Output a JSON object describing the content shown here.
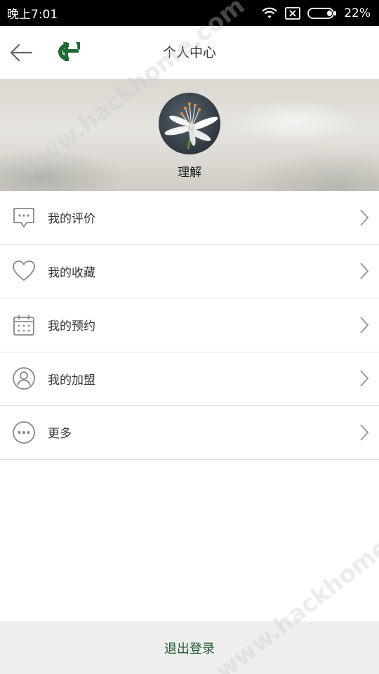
{
  "status_bar": {
    "time": "晚上7:01",
    "battery": "22%"
  },
  "header": {
    "title": "个人中心"
  },
  "profile": {
    "username": "理解"
  },
  "menu": {
    "items": [
      {
        "label": "我的评价",
        "icon": "comment-icon"
      },
      {
        "label": "我的收藏",
        "icon": "heart-icon"
      },
      {
        "label": "我的预约",
        "icon": "calendar-icon"
      },
      {
        "label": "我的加盟",
        "icon": "user-circle-icon"
      },
      {
        "label": "更多",
        "icon": "more-icon"
      }
    ]
  },
  "logout": {
    "label": "退出登录"
  },
  "watermark": {
    "text": "www.hackhome.com"
  },
  "colors": {
    "accent": "#1f5a2c",
    "logo": "#1e6b35",
    "divider": "#e0e0e0",
    "icon": "#888888"
  }
}
